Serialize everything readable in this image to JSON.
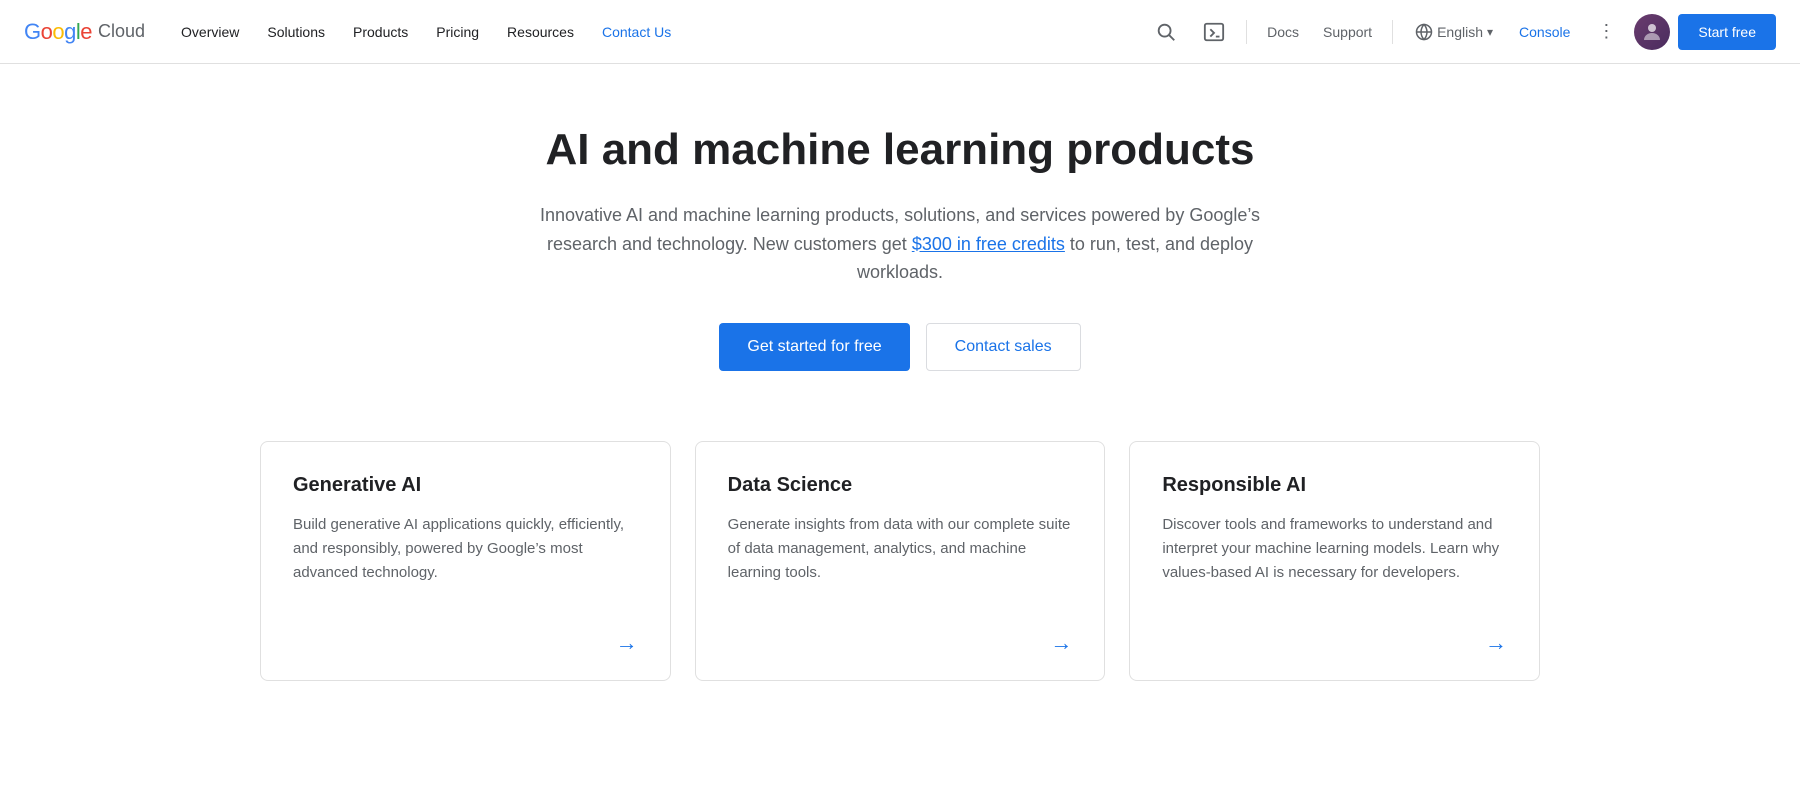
{
  "navbar": {
    "logo_google": "Google",
    "logo_cloud": "Cloud",
    "nav_links": [
      {
        "id": "overview",
        "label": "Overview",
        "active": false
      },
      {
        "id": "solutions",
        "label": "Solutions",
        "active": false
      },
      {
        "id": "products",
        "label": "Products",
        "active": false
      },
      {
        "id": "pricing",
        "label": "Pricing",
        "active": false
      },
      {
        "id": "resources",
        "label": "Resources",
        "active": false
      },
      {
        "id": "contact",
        "label": "Contact Us",
        "active": true
      }
    ],
    "docs_label": "Docs",
    "support_label": "Support",
    "language_label": "English",
    "console_label": "Console",
    "start_free_label": "Start free"
  },
  "hero": {
    "title": "AI and machine learning products",
    "subtitle_start": "Innovative AI and machine learning products, solutions, and services powered by Google’s research and technology. New customers get ",
    "free_credits_link": "$300 in free credits",
    "subtitle_end": " to run, test, and deploy workloads.",
    "cta_primary": "Get started for free",
    "cta_secondary": "Contact sales"
  },
  "cards": [
    {
      "id": "generative-ai",
      "title": "Generative AI",
      "description": "Build generative AI applications quickly, efficiently, and responsibly, powered by Google’s most advanced technology.",
      "arrow": "→"
    },
    {
      "id": "data-science",
      "title": "Data Science",
      "description": "Generate insights from data with our complete suite of data management, analytics, and machine learning tools.",
      "arrow": "→"
    },
    {
      "id": "responsible-ai",
      "title": "Responsible AI",
      "description": "Discover tools and frameworks to understand and interpret your machine learning models. Learn why values-based AI is necessary for developers.",
      "arrow": "→"
    }
  ],
  "colors": {
    "primary_blue": "#1a73e8",
    "text_dark": "#202124",
    "text_gray": "#5f6368",
    "border": "#e0e0e0"
  }
}
